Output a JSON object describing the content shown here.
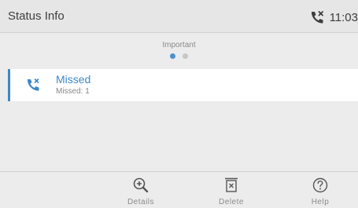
{
  "header": {
    "title": "Status Info",
    "clock": "11:03",
    "missed_call_icon": "missed-call-icon"
  },
  "pager": {
    "label": "Important",
    "pages": 2,
    "current": 1
  },
  "list": {
    "items": [
      {
        "icon": "missed-call-icon",
        "title": "Missed",
        "subtitle": "Missed: 1"
      }
    ]
  },
  "softkeys": {
    "details": {
      "label": "Details",
      "icon": "zoom-in-icon"
    },
    "delete": {
      "label": "Delete",
      "icon": "delete-box-icon"
    },
    "help": {
      "label": "Help",
      "icon": "help-icon"
    }
  },
  "colors": {
    "accent": "#3d87c9",
    "dot_active": "#4a90d1",
    "dot_inactive": "#c6c6c6",
    "background": "#ececec"
  }
}
